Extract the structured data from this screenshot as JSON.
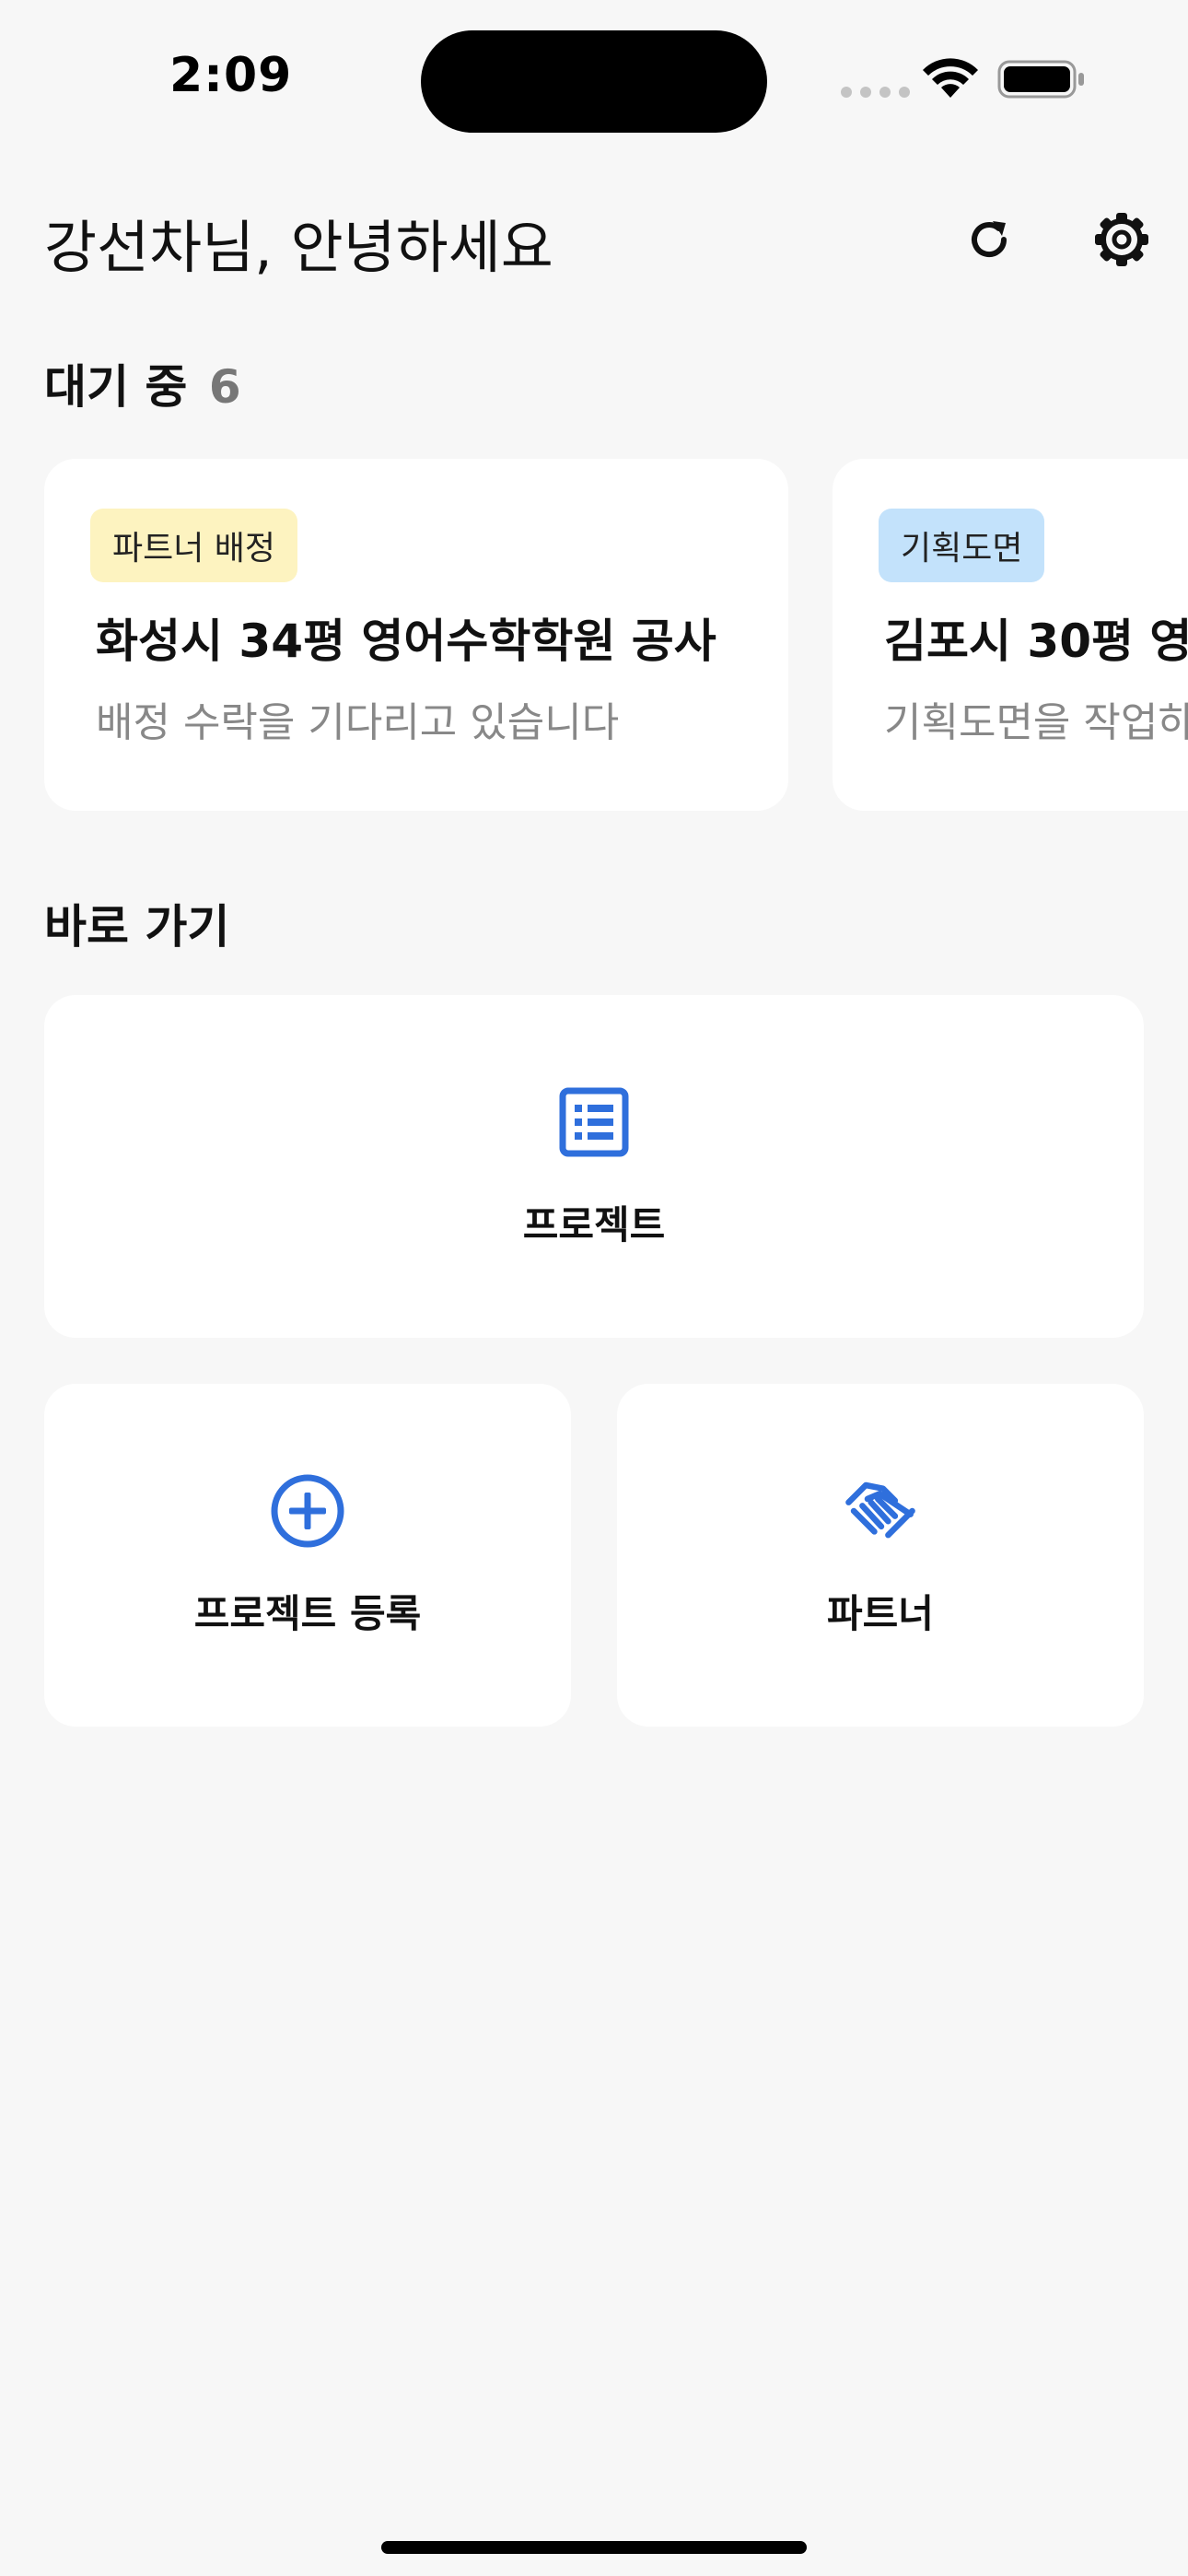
{
  "status_bar": {
    "time": "2:09",
    "wifi_icon": "wifi-icon",
    "battery_icon": "battery-full-icon"
  },
  "header": {
    "greeting": "강선차님, 안녕하세요",
    "refresh_icon": "refresh-icon",
    "settings_icon": "gear-icon"
  },
  "waiting": {
    "title": "대기 중",
    "count": "6",
    "cards": [
      {
        "badge": "파트너 배정",
        "badge_color": "#fdf3c0",
        "title": "화성시 34평 영어수학학원 공사",
        "subtitle": "배정 수락을 기다리고 있습니다"
      },
      {
        "badge": "기획도면",
        "badge_color": "#c3e2fb",
        "title": "김포시 30평 영",
        "subtitle": "기획도면을 작업하"
      }
    ]
  },
  "shortcuts": {
    "title": "바로 가기",
    "accent_color": "#2f6fdc",
    "items": [
      {
        "label": "프로젝트",
        "icon": "list-icon"
      },
      {
        "label": "프로젝트 등록",
        "icon": "plus-circle-icon"
      },
      {
        "label": "파트너",
        "icon": "handshake-icon"
      }
    ]
  }
}
